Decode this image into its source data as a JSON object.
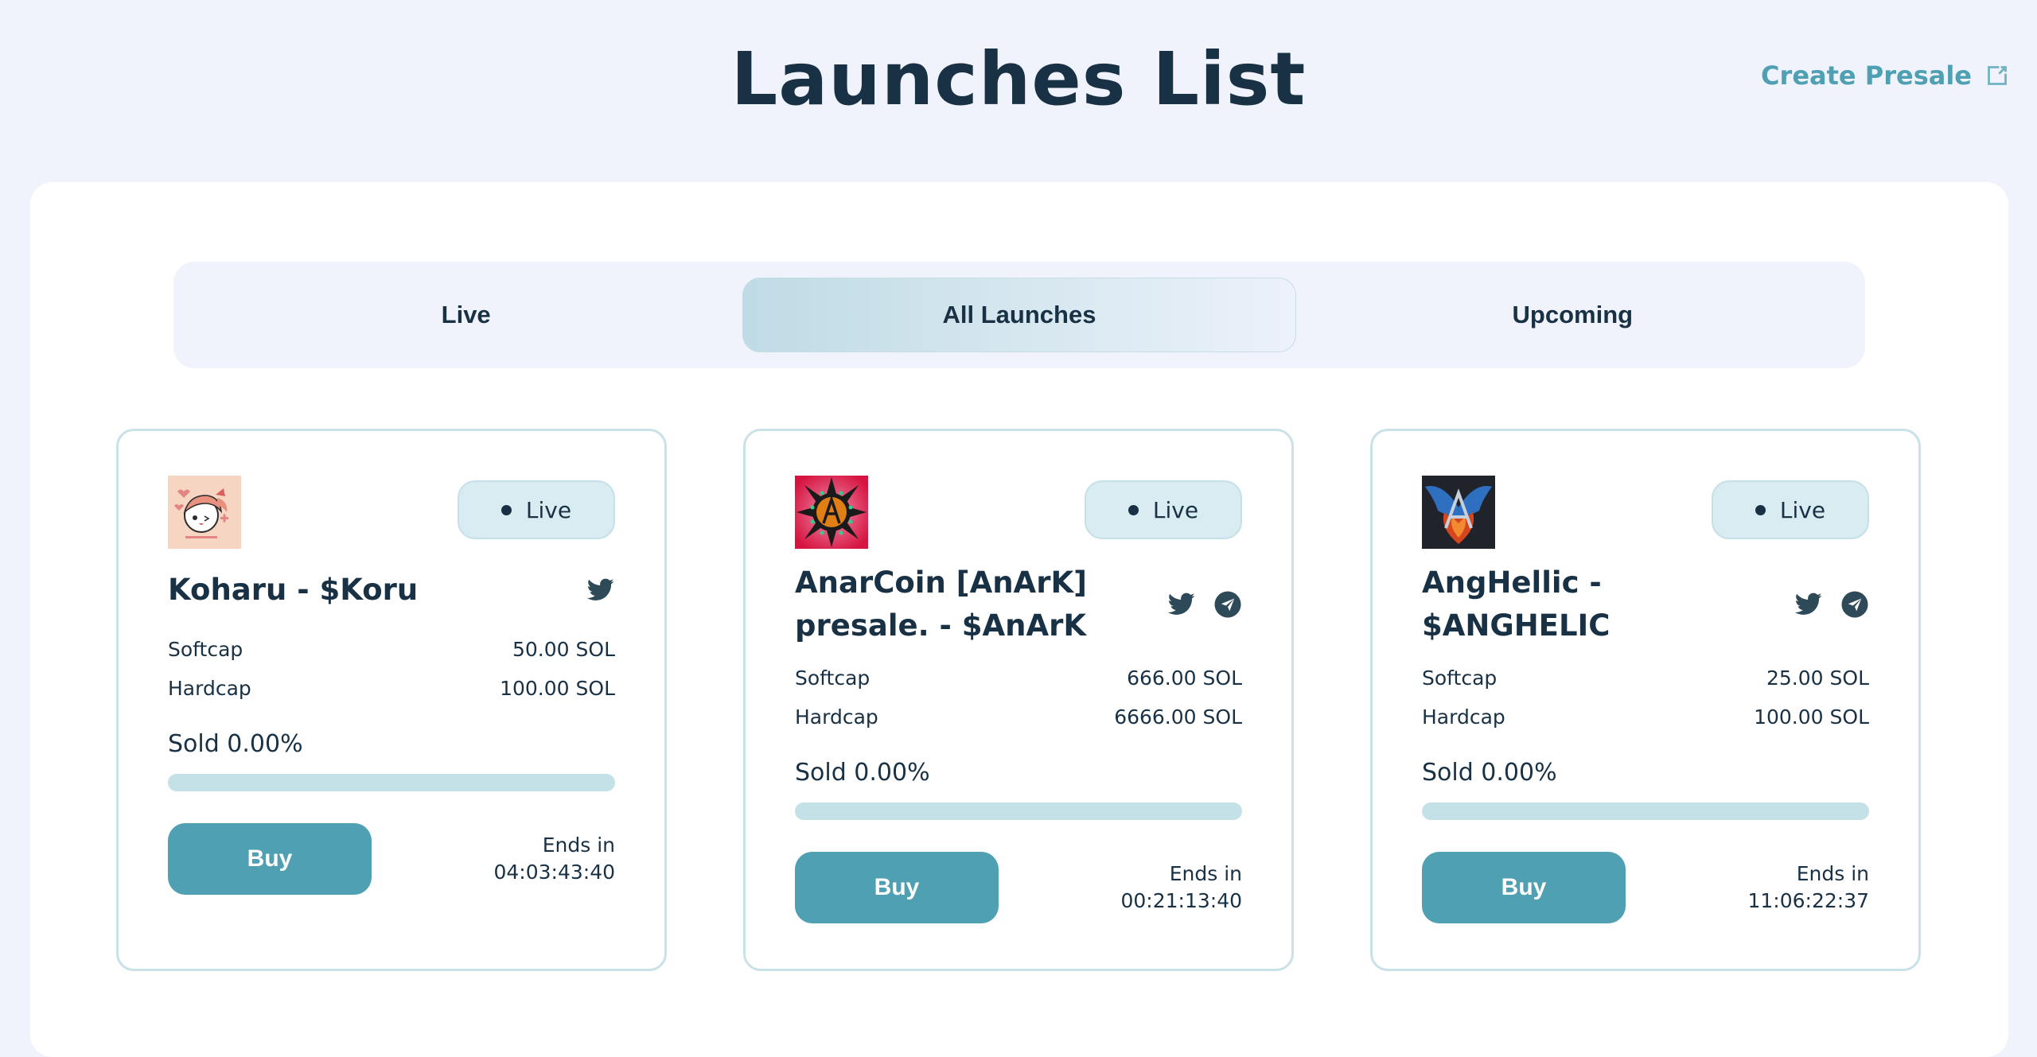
{
  "header": {
    "title": "Launches List",
    "create_presale_label": "Create Presale",
    "create_presale_icon": "external-link-icon"
  },
  "colors": {
    "page_bg": "#f0f3fc",
    "text_primary": "#193144",
    "accent": "#4fa0b2",
    "badge_bg": "#d9ecf1",
    "progress_track": "#c3e1e7",
    "card_border": "#c8e2e8"
  },
  "tabs": [
    {
      "label": "Live",
      "active": false
    },
    {
      "label": "All Launches",
      "active": true
    },
    {
      "label": "Upcoming",
      "active": false
    }
  ],
  "cards": [
    {
      "name": "Koharu - $Koru",
      "logo": "koharu-anime-logo",
      "status": "Live",
      "socials": [
        "twitter-icon"
      ],
      "softcap_label": "Softcap",
      "softcap_value": "50.00 SOL",
      "hardcap_label": "Hardcap",
      "hardcap_value": "100.00 SOL",
      "sold_label": "Sold 0.00%",
      "sold_percent": 0,
      "buy_label": "Buy",
      "ends_label": "Ends in",
      "ends_value": "04:03:43:40"
    },
    {
      "name": "AnarCoin [AnArK] presale. - $AnArK",
      "logo": "anarcoin-chaos-star-logo",
      "status": "Live",
      "socials": [
        "twitter-icon",
        "telegram-icon"
      ],
      "softcap_label": "Softcap",
      "softcap_value": "666.00 SOL",
      "hardcap_label": "Hardcap",
      "hardcap_value": "6666.00 SOL",
      "sold_label": "Sold 0.00%",
      "sold_percent": 0,
      "buy_label": "Buy",
      "ends_label": "Ends in",
      "ends_value": "00:21:13:40"
    },
    {
      "name": "AngHellic - $ANGHELIC",
      "logo": "anghellic-winged-logo",
      "status": "Live",
      "socials": [
        "twitter-icon",
        "telegram-icon"
      ],
      "softcap_label": "Softcap",
      "softcap_value": "25.00 SOL",
      "hardcap_label": "Hardcap",
      "hardcap_value": "100.00 SOL",
      "sold_label": "Sold 0.00%",
      "sold_percent": 0,
      "buy_label": "Buy",
      "ends_label": "Ends in",
      "ends_value": "11:06:22:37"
    }
  ]
}
